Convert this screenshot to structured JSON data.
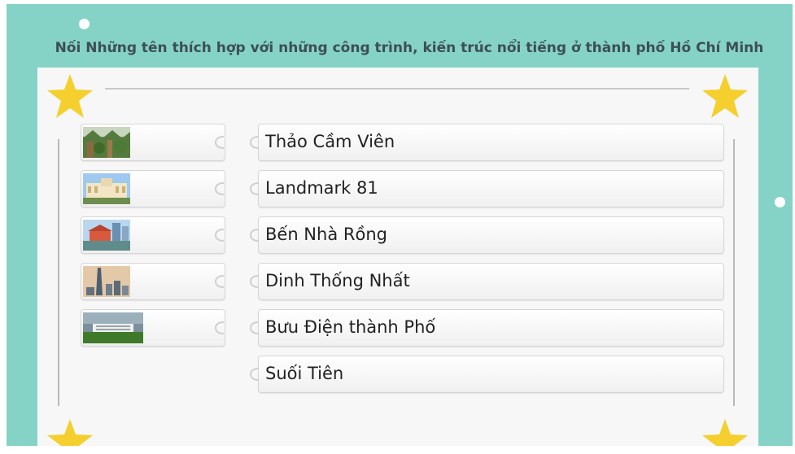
{
  "title": "Nối Những tên thích hợp với những công trình, kiến trúc nổi tiếng ở thành phố Hồ Chí Minh",
  "colors": {
    "frame": "#84d3c6",
    "board": "#f7f7f7",
    "star": "#f4cf2e",
    "title": "#3e4e55"
  },
  "image_tiles": [
    {
      "icon": "garden-photo"
    },
    {
      "icon": "post-office-photo"
    },
    {
      "icon": "nha-rong-wharf-photo"
    },
    {
      "icon": "landmark-81-skyline-photo"
    },
    {
      "icon": "independence-palace-photo"
    }
  ],
  "name_tiles": [
    {
      "label": "Thảo Cầm Viên"
    },
    {
      "label": "Landmark 81"
    },
    {
      "label": "Bến Nhà Rồng"
    },
    {
      "label": "Dinh Thống Nhất"
    },
    {
      "label": "Bưu Điện thành Phố"
    },
    {
      "label": "Suối Tiên"
    }
  ]
}
